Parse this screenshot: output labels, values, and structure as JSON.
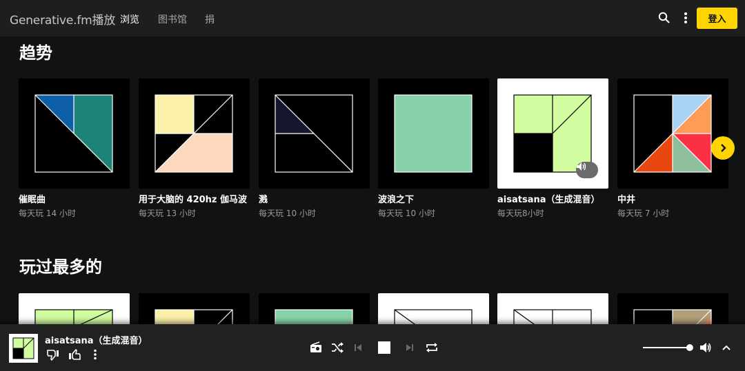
{
  "app": {
    "brand": "Generative.fm播放",
    "nav": [
      "浏览",
      "图书馆",
      "捐"
    ],
    "login_label": "登入"
  },
  "trending": {
    "title": "趋势",
    "cards": [
      {
        "title": "催眠曲",
        "sub": "每天玩 14 小时"
      },
      {
        "title": "用于大脑的 420hz 伽马波",
        "sub": "每天玩 13 小时"
      },
      {
        "title": "溅",
        "sub": "每天玩 10 小时"
      },
      {
        "title": "波浪之下",
        "sub": "每天玩 10 小时"
      },
      {
        "title": "aisatsana（生成混音）",
        "sub": "每天玩8小时"
      },
      {
        "title": "中井",
        "sub": "每天玩 7 小时"
      }
    ]
  },
  "most_played": {
    "title": "玩过最多的"
  },
  "player": {
    "title": "aisatsana（生成混音）",
    "volume": 0.97
  },
  "icons": {
    "search": "search-icon",
    "more": "more-vert-icon",
    "next": "chevron-right-icon",
    "volume": "volume-icon"
  }
}
